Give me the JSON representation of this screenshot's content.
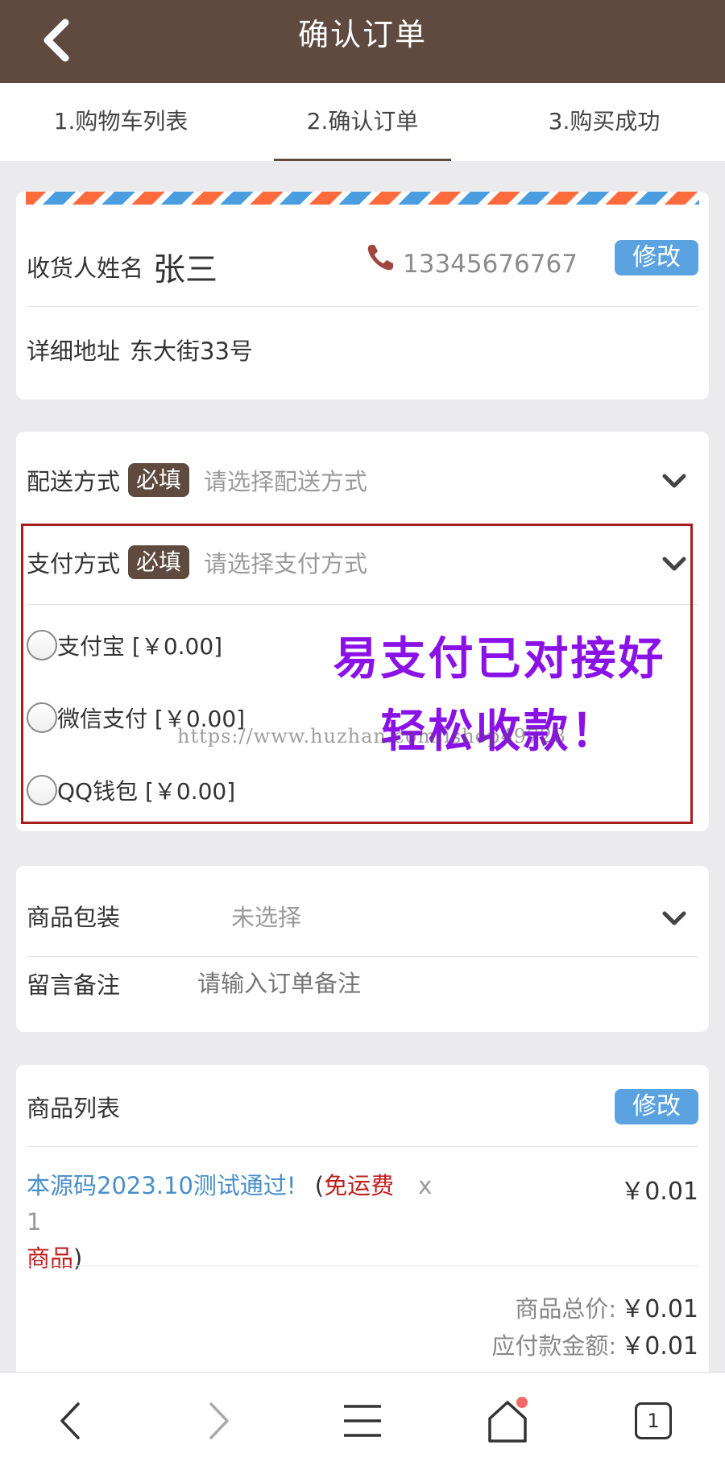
{
  "header": {
    "title": "确认订单"
  },
  "steps": [
    {
      "label": "1.购物车列表"
    },
    {
      "label": "2.确认订单"
    },
    {
      "label": "3.购买成功"
    }
  ],
  "address": {
    "name_label": "收货人姓名",
    "name": "张三",
    "phone": "13345676767",
    "edit_label": "修改",
    "address_label": "详细地址",
    "address": "东大街33号"
  },
  "delivery": {
    "label": "配送方式",
    "required": "必填",
    "placeholder": "请选择配送方式"
  },
  "payment": {
    "label": "支付方式",
    "required": "必填",
    "placeholder": "请选择支付方式",
    "options": [
      {
        "label": "支付宝 [￥0.00]"
      },
      {
        "label": "微信支付 [￥0.00]"
      },
      {
        "label": "QQ钱包 [￥0.00]"
      }
    ],
    "promo_line1": "易支付已对接好",
    "promo_line2": "轻松收款！",
    "watermark": "https://www.huzhan.com/ishop49728"
  },
  "extras": {
    "packaging_label": "商品包装",
    "packaging_value": "未选择",
    "note_label": "留言备注",
    "note_placeholder": "请输入订单备注"
  },
  "products": {
    "title": "商品列表",
    "edit_label": "修改",
    "items": [
      {
        "name": "本源码2023.10测试通过!",
        "tag_open": "(",
        "tag": "免运费",
        "tag2": "商品",
        "tag_close": ")",
        "qty": "x 1",
        "price": "￥0.01"
      }
    ],
    "total_label": "商品总价:",
    "total_value": "￥0.01",
    "payable_label": "应付款金额:",
    "payable_value": "￥0.01"
  },
  "bottom_nav": {
    "tab_count": "1"
  },
  "colors": {
    "brand": "#5f4a3f",
    "accent": "#5ba3e0",
    "promo": "#8a12e6",
    "highlight_box": "#a61e1e"
  }
}
